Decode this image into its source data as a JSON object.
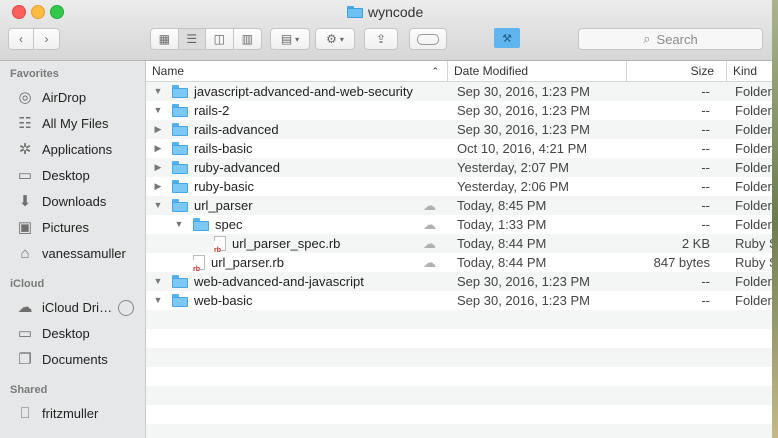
{
  "window": {
    "title": "wyncode"
  },
  "toolbar": {
    "view_buttons": [
      "icon-view",
      "list-view",
      "column-view",
      "cover-flow-view"
    ],
    "search_placeholder": "Search"
  },
  "sidebar": {
    "sections": [
      {
        "heading": "Favorites",
        "items": [
          {
            "label": "AirDrop",
            "icon": "airdrop-icon"
          },
          {
            "label": "All My Files",
            "icon": "all-files-icon"
          },
          {
            "label": "Applications",
            "icon": "applications-icon"
          },
          {
            "label": "Desktop",
            "icon": "desktop-icon"
          },
          {
            "label": "Downloads",
            "icon": "downloads-icon"
          },
          {
            "label": "Pictures",
            "icon": "pictures-icon"
          },
          {
            "label": "vanessamuller",
            "icon": "home-icon"
          }
        ]
      },
      {
        "heading": "iCloud",
        "items": [
          {
            "label": "iCloud Dri…",
            "icon": "cloud-icon"
          },
          {
            "label": "Desktop",
            "icon": "desktop-icon"
          },
          {
            "label": "Documents",
            "icon": "documents-icon"
          }
        ]
      },
      {
        "heading": "Shared",
        "items": [
          {
            "label": "fritzmuller",
            "icon": "computer-icon"
          }
        ]
      }
    ]
  },
  "columns": {
    "name": "Name",
    "date": "Date Modified",
    "size": "Size",
    "kind": "Kind"
  },
  "rows": [
    {
      "name": "javascript-advanced-and-web-security",
      "date": "Sep 30, 2016, 1:23 PM",
      "size": "--",
      "kind": "Folder",
      "type": "folder",
      "level": 0,
      "expanded": true,
      "cloud": false
    },
    {
      "name": "rails-2",
      "date": "Sep 30, 2016, 1:23 PM",
      "size": "--",
      "kind": "Folder",
      "type": "folder",
      "level": 0,
      "expanded": true,
      "cloud": false
    },
    {
      "name": "rails-advanced",
      "date": "Sep 30, 2016, 1:23 PM",
      "size": "--",
      "kind": "Folder",
      "type": "folder",
      "level": 0,
      "expanded": false,
      "cloud": false
    },
    {
      "name": "rails-basic",
      "date": "Oct 10, 2016, 4:21 PM",
      "size": "--",
      "kind": "Folder",
      "type": "folder",
      "level": 0,
      "expanded": false,
      "cloud": false
    },
    {
      "name": "ruby-advanced",
      "date": "Yesterday, 2:07 PM",
      "size": "--",
      "kind": "Folder",
      "type": "folder",
      "level": 0,
      "expanded": false,
      "cloud": false
    },
    {
      "name": "ruby-basic",
      "date": "Yesterday, 2:06 PM",
      "size": "--",
      "kind": "Folder",
      "type": "folder",
      "level": 0,
      "expanded": false,
      "cloud": false
    },
    {
      "name": "url_parser",
      "date": "Today, 8:45 PM",
      "size": "--",
      "kind": "Folder",
      "type": "folder",
      "level": 0,
      "expanded": true,
      "cloud": true
    },
    {
      "name": "spec",
      "date": "Today, 1:33 PM",
      "size": "--",
      "kind": "Folder",
      "type": "folder",
      "level": 1,
      "expanded": true,
      "cloud": true
    },
    {
      "name": "url_parser_spec.rb",
      "date": "Today, 8:44 PM",
      "size": "2 KB",
      "kind": "Ruby S",
      "type": "file",
      "level": 2,
      "cloud": true
    },
    {
      "name": "url_parser.rb",
      "date": "Today, 8:44 PM",
      "size": "847 bytes",
      "kind": "Ruby S",
      "type": "file",
      "level": 1,
      "cloud": true
    },
    {
      "name": "web-advanced-and-javascript",
      "date": "Sep 30, 2016, 1:23 PM",
      "size": "--",
      "kind": "Folder",
      "type": "folder",
      "level": 0,
      "expanded": true,
      "cloud": false
    },
    {
      "name": "web-basic",
      "date": "Sep 30, 2016, 1:23 PM",
      "size": "--",
      "kind": "Folder",
      "type": "folder",
      "level": 0,
      "expanded": true,
      "cloud": false
    }
  ]
}
